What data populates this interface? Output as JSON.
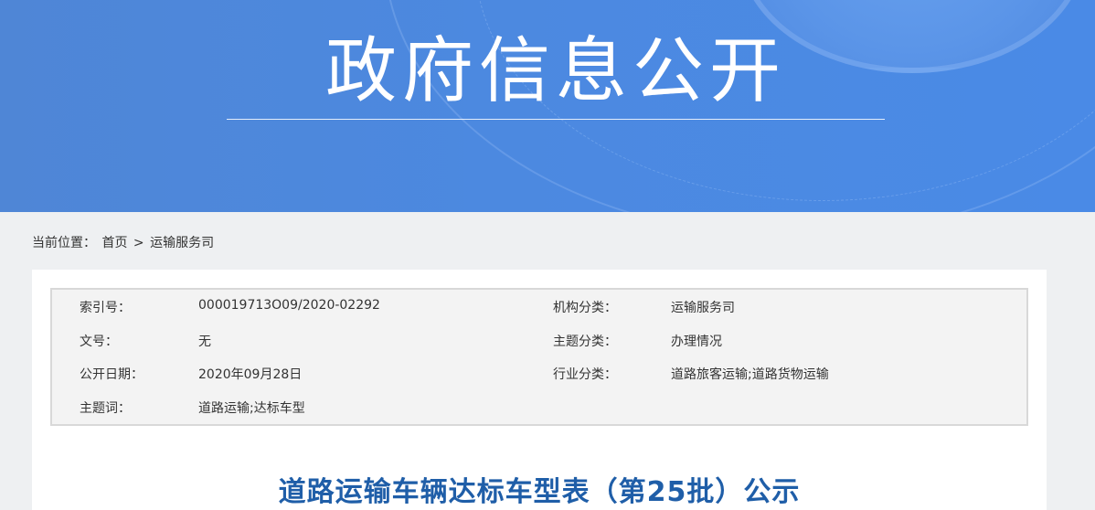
{
  "banner": {
    "title": "政府信息公开"
  },
  "breadcrumb": {
    "prefix": "当前位置：",
    "home": "首页",
    "separator": ">",
    "current": "运输服务司"
  },
  "info": {
    "rows": [
      {
        "label1": "索引号：",
        "value1": "000019713O09/2020-02292",
        "label2": "机构分类：",
        "value2": "运输服务司"
      },
      {
        "label1": "文号：",
        "value1": "无",
        "label2": "主题分类：",
        "value2": "办理情况"
      },
      {
        "label1": "公开日期：",
        "value1": "2020年09月28日",
        "label2": "行业分类：",
        "value2": "道路旅客运输;道路货物运输"
      },
      {
        "label1": "主题词：",
        "value1": "道路运输;达标车型",
        "label2": "",
        "value2": ""
      }
    ]
  },
  "article": {
    "title": "道路运输车辆达标车型表（第25批）公示"
  }
}
